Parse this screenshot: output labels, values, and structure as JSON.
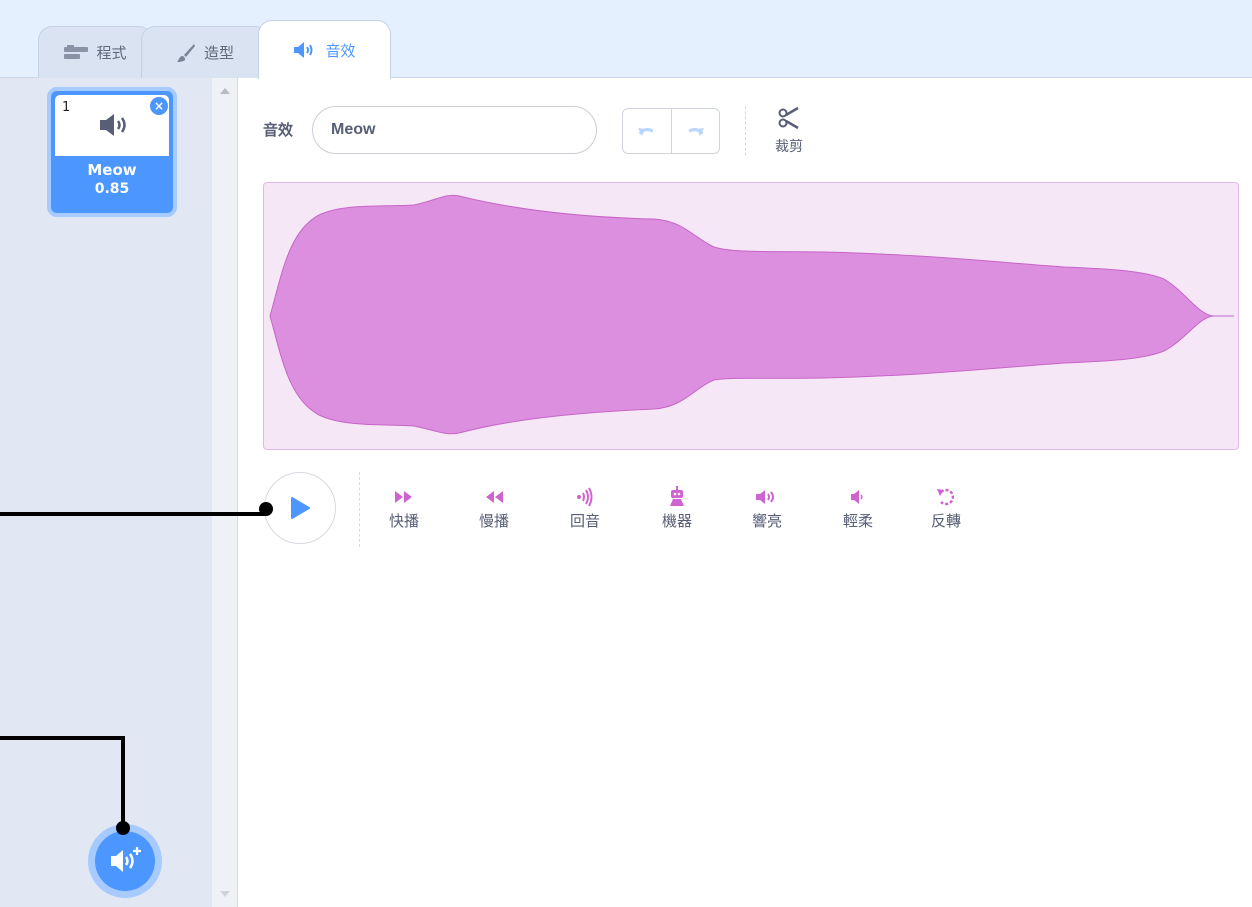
{
  "tabs": [
    {
      "label": "程式",
      "icon": "code-blocks-icon"
    },
    {
      "label": "造型",
      "icon": "paintbrush-icon"
    },
    {
      "label": "音效",
      "icon": "speaker-icon"
    }
  ],
  "active_tab": "音效",
  "sound_list": [
    {
      "index": "1",
      "name": "Meow",
      "duration": "0.85",
      "icon": "speaker-icon",
      "delete_icon": "close-icon"
    }
  ],
  "editor": {
    "name_label": "音效",
    "name_value": "Meow",
    "undo_icon": "undo-icon",
    "redo_icon": "redo-icon",
    "trim_label": "裁剪",
    "trim_icon": "scissors-icon"
  },
  "effects": [
    {
      "label": "快播",
      "icon": "fast-forward-icon"
    },
    {
      "label": "慢播",
      "icon": "rewind-icon"
    },
    {
      "label": "回音",
      "icon": "echo-icon"
    },
    {
      "label": "機器",
      "icon": "robot-icon"
    },
    {
      "label": "響亮",
      "icon": "louder-icon"
    },
    {
      "label": "輕柔",
      "icon": "softer-icon"
    },
    {
      "label": "反轉",
      "icon": "reverse-icon"
    }
  ],
  "colors": {
    "accent": "#4c97ff",
    "waveform_fill": "#db8fde",
    "waveform_bg": "#f6e7f6",
    "effect_icon": "#cf63cf",
    "text": "#575e75"
  }
}
